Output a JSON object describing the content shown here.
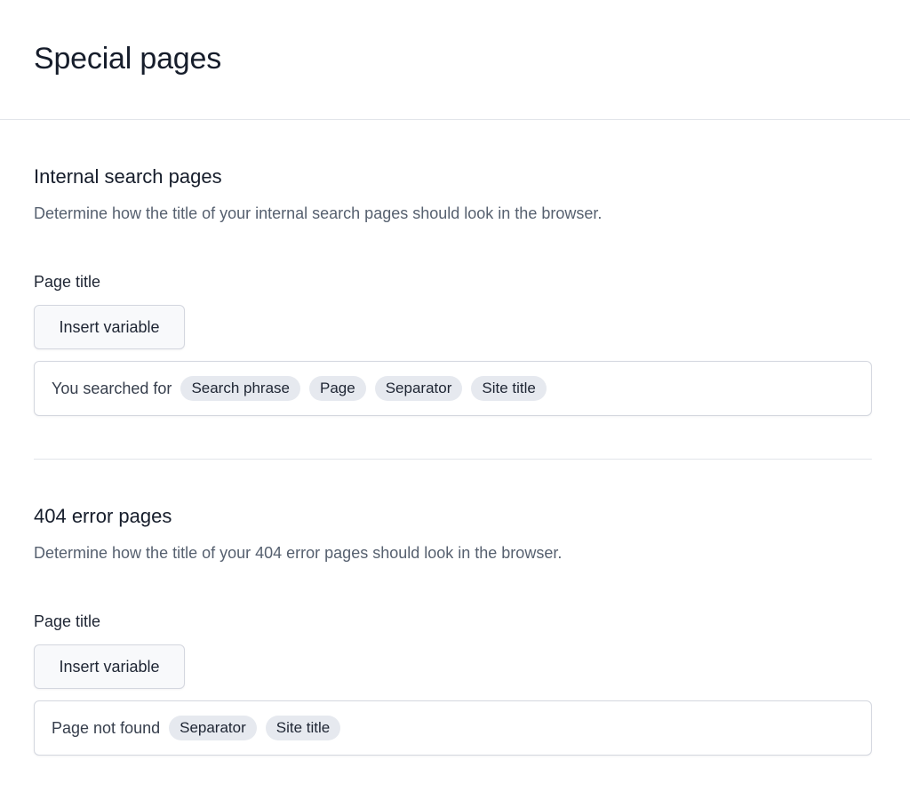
{
  "page": {
    "title": "Special pages"
  },
  "sections": [
    {
      "title": "Internal search pages",
      "description": "Determine how the title of your internal search pages should look in the browser.",
      "field_label": "Page title",
      "insert_button_label": "Insert variable",
      "input": {
        "text": "You searched for",
        "chips": [
          "Search phrase",
          "Page",
          "Separator",
          "Site title"
        ]
      }
    },
    {
      "title": "404 error pages",
      "description": "Determine how the title of your 404 error pages should look in the browser.",
      "field_label": "Page title",
      "insert_button_label": "Insert variable",
      "input": {
        "text": "Page not found",
        "chips": [
          "Separator",
          "Site title"
        ]
      }
    }
  ],
  "colors": {
    "chip_bg": "#e6e9ef",
    "border": "#d4d7df",
    "muted_text": "#56606f"
  }
}
